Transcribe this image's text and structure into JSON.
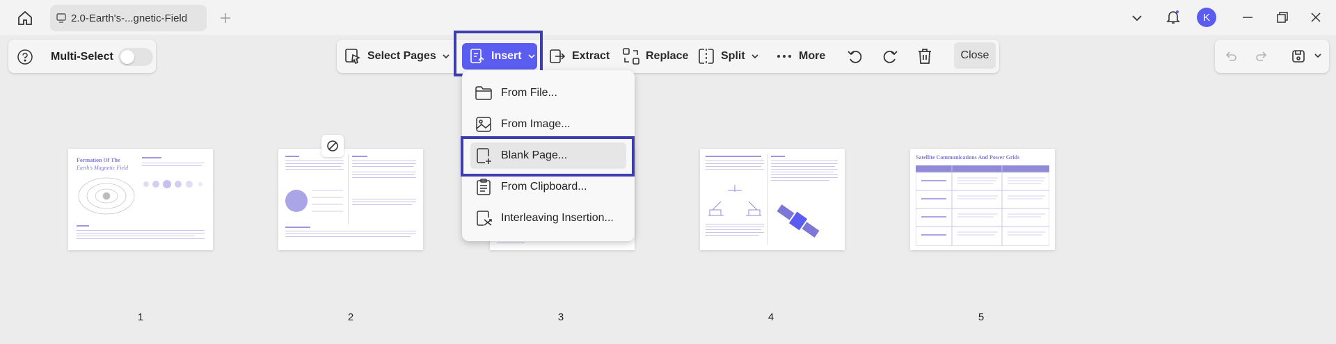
{
  "titlebar": {
    "tab_title": "2.0-Earth's-...gnetic-Field",
    "avatar_initial": "K",
    "icons": [
      "home-icon",
      "document-tab-icon",
      "plus-icon",
      "chevron-down-icon",
      "bell-icon",
      "minimize-icon",
      "restore-icon",
      "close-icon"
    ]
  },
  "left_panel": {
    "multi_select_label": "Multi-Select",
    "toggle_on": false
  },
  "toolbar": {
    "select_pages": "Select Pages",
    "insert": "Insert",
    "extract": "Extract",
    "replace": "Replace",
    "split": "Split",
    "more": "More",
    "close": "Close"
  },
  "insert_menu": {
    "items": [
      {
        "label": "From File...",
        "icon": "folder-icon"
      },
      {
        "label": "From Image...",
        "icon": "image-icon"
      },
      {
        "label": "Blank Page...",
        "icon": "blank-page-icon",
        "highlighted": true
      },
      {
        "label": "From Clipboard...",
        "icon": "clipboard-icon"
      },
      {
        "label": "Interleaving Insertion...",
        "icon": "interleave-icon"
      }
    ]
  },
  "pages": [
    {
      "number": "1",
      "heading": "Formation Of The",
      "subheading": "Earth's Magnetic Field"
    },
    {
      "number": "2"
    },
    {
      "number": "3"
    },
    {
      "number": "4"
    },
    {
      "number": "5",
      "heading": "Satellite Communications And Power Grids"
    }
  ],
  "colors": {
    "accent": "#5b5cf0",
    "highlight_border": "#3d3db0",
    "thumb_text": "#7e7ad6"
  }
}
